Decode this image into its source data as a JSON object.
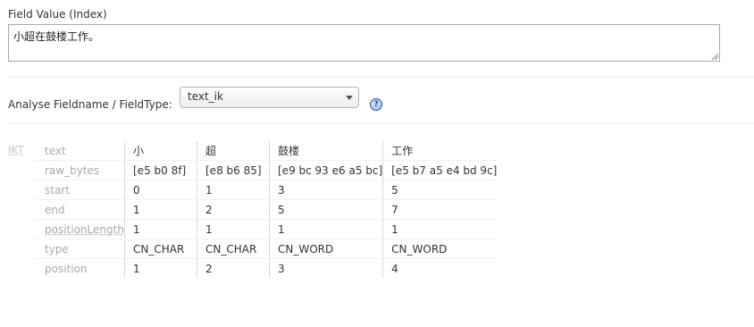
{
  "field_value": {
    "label": "Field Value (Index)",
    "text": "小超在鼓楼工作。"
  },
  "analyse": {
    "label": "Analyse Fieldname / FieldType:",
    "selected": "text_ik",
    "help_glyph": "?"
  },
  "analyzer": {
    "name": "IKT"
  },
  "rows": [
    {
      "key": "text",
      "values": [
        "小",
        "超",
        "鼓楼",
        "工作"
      ]
    },
    {
      "key": "raw_bytes",
      "values": [
        "[e5 b0 8f]",
        "[e8 b6 85]",
        "[e9 bc 93 e6 a5 bc]",
        "[e5 b7 a5 e4 bd 9c]"
      ]
    },
    {
      "key": "start",
      "values": [
        "0",
        "1",
        "3",
        "5"
      ]
    },
    {
      "key": "end",
      "values": [
        "1",
        "2",
        "5",
        "7"
      ]
    },
    {
      "key": "positionLength",
      "values": [
        "1",
        "1",
        "1",
        "1"
      ]
    },
    {
      "key": "type",
      "values": [
        "CN_CHAR",
        "CN_CHAR",
        "CN_WORD",
        "CN_WORD"
      ]
    },
    {
      "key": "position",
      "values": [
        "1",
        "2",
        "3",
        "4"
      ]
    }
  ],
  "icons": {
    "help": "help-icon",
    "dropdown": "chevron-down-icon",
    "resize": "resize-grip-icon"
  }
}
